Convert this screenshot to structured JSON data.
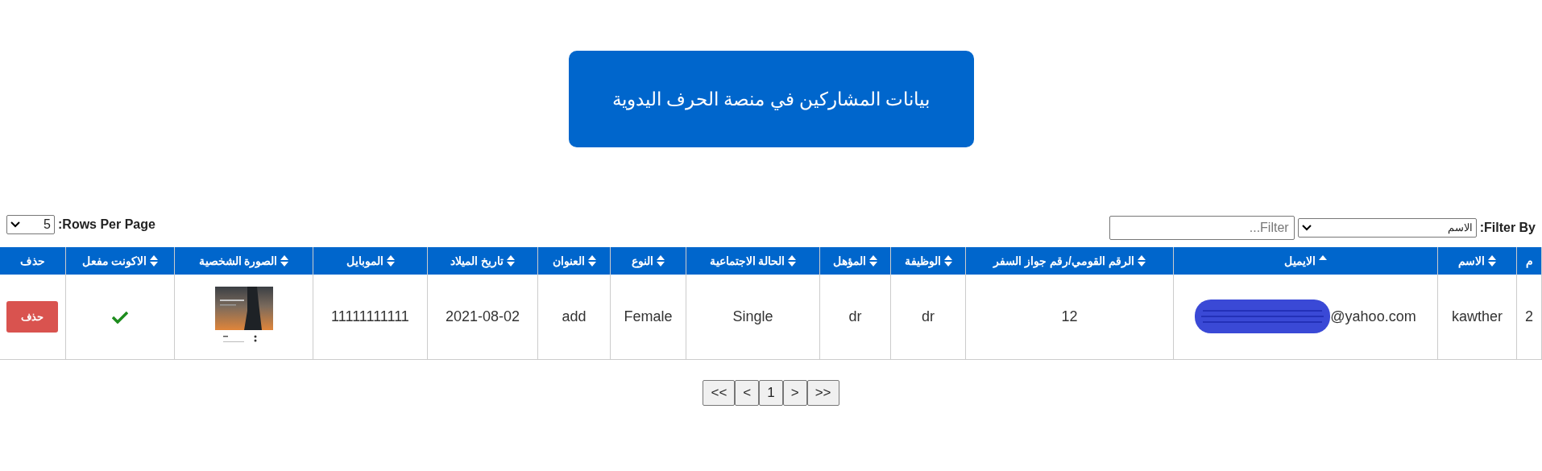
{
  "title": "بيانات المشاركين في منصة الحرف اليدوية",
  "filter": {
    "label": "Filter By:",
    "select_value": "الاسم",
    "placeholder": "Filter..."
  },
  "rows_per_page": {
    "label": "Rows Per Page:",
    "value": "5"
  },
  "table": {
    "columns": [
      {
        "label": "م",
        "sortable": false
      },
      {
        "label": "الاسم",
        "sortable": true
      },
      {
        "label": "الايميل",
        "sortable": true,
        "sorted": true
      },
      {
        "label": "الرقم القومي/رقم جواز السفر",
        "sortable": true
      },
      {
        "label": "الوظيفة",
        "sortable": true
      },
      {
        "label": "المؤهل",
        "sortable": true
      },
      {
        "label": "الحالة الاجتماعية",
        "sortable": true
      },
      {
        "label": "النوع",
        "sortable": true
      },
      {
        "label": "العنوان",
        "sortable": true
      },
      {
        "label": "تاريخ الميلاد",
        "sortable": true
      },
      {
        "label": "الموبايل",
        "sortable": true
      },
      {
        "label": "الصورة الشخصية",
        "sortable": true
      },
      {
        "label": "الاكونت مفعل",
        "sortable": true
      },
      {
        "label": "حذف",
        "sortable": false
      }
    ],
    "rows": [
      {
        "cells": [
          {
            "kind": "text",
            "text": "2"
          },
          {
            "kind": "text",
            "text": "kawther"
          },
          {
            "kind": "email",
            "text": "@yahoo.com",
            "redacted": true
          },
          {
            "kind": "text",
            "text": "12"
          },
          {
            "kind": "text",
            "text": "dr"
          },
          {
            "kind": "text",
            "text": "dr"
          },
          {
            "kind": "text",
            "text": "Single"
          },
          {
            "kind": "text",
            "text": "Female"
          },
          {
            "kind": "text",
            "text": "add"
          },
          {
            "kind": "text",
            "text": "2021-08-02"
          },
          {
            "kind": "text",
            "text": "11111111111"
          },
          {
            "kind": "picture"
          },
          {
            "kind": "check",
            "checked": true
          },
          {
            "kind": "button",
            "text": "حذف"
          }
        ]
      }
    ]
  },
  "pagination": [
    ">>",
    ">",
    "1",
    "<",
    "<<"
  ]
}
